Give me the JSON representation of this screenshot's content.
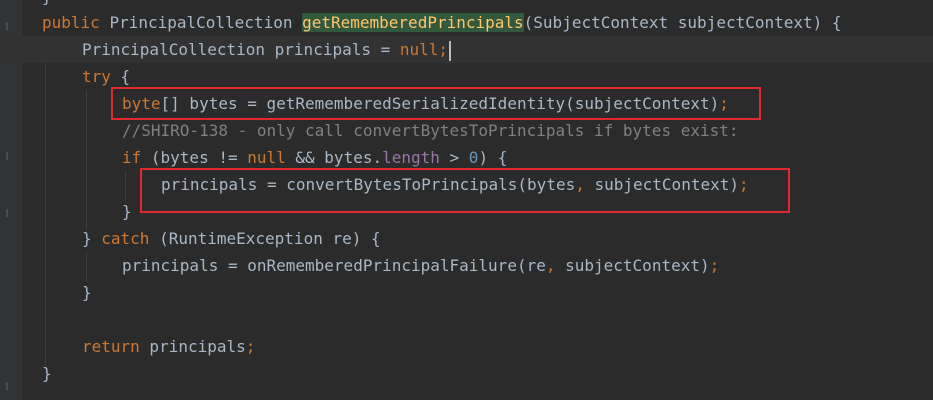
{
  "code": {
    "l0_top": "}",
    "l1_public": "public ",
    "l1_type": "PrincipalCollection ",
    "l1_method": "getRememberedPrincipals",
    "l1_params": "(SubjectContext subjectContext) {",
    "l2_decl": "PrincipalCollection principals = ",
    "l2_null": "null",
    "l2_semi": ";",
    "l3_try": "try",
    "l3_brace": " {",
    "l4_byte": "byte",
    "l4_rest": "[] bytes = getRememberedSerializedIdentity(subjectContext)",
    "l4_semi": ";",
    "l5_comment": "//SHIRO-138 - only call convertBytesToPrincipals if bytes exist:",
    "l6_if": "if",
    "l6_a": " (bytes != ",
    "l6_null": "null",
    "l6_b": " && bytes.",
    "l6_length": "length",
    "l6_c": " > ",
    "l6_zero": "0",
    "l6_d": ") {",
    "l7_a": "principals = convertBytesToPrincipals(bytes",
    "l7_comma": ",",
    "l7_b": " subjectContext)",
    "l7_semi": ";",
    "l8_close": "}",
    "l9_open": "} ",
    "l9_catch": "catch",
    "l9_rest": " (RuntimeException re) {",
    "l10_a": "principals = onRememberedPrincipalFailure(re",
    "l10_comma": ",",
    "l10_b": " subjectContext)",
    "l10_semi": ";",
    "l11_close": "}",
    "l13_return": "return",
    "l13_rest": " principals",
    "l13_semi": ";",
    "l14_close": "}"
  },
  "colors": {
    "background": "#2b2b2b",
    "keyword": "#cc7832",
    "method": "#ffc66d",
    "field": "#9876aa",
    "number": "#6897bb",
    "comment": "#808080",
    "text": "#a9b7c6",
    "annotation_box": "#e0282f"
  }
}
